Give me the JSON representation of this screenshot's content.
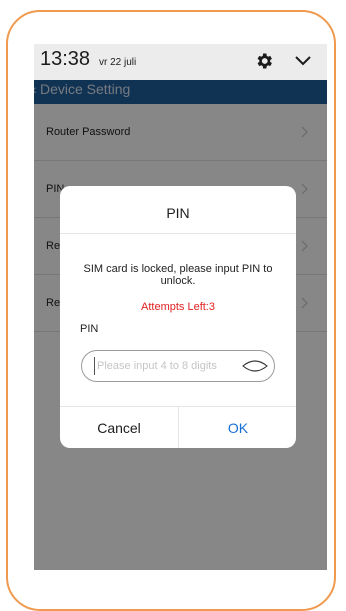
{
  "status_bar": {
    "time": "13:38",
    "date": "vr 22 juli",
    "icons": [
      "gear-icon",
      "chevron-down-icon"
    ]
  },
  "app_bar": {
    "title": "Device Setting",
    "back_icon": "back-arrow-icon",
    "color": "#1f5f9e"
  },
  "settings_list": [
    {
      "label": "Router Password"
    },
    {
      "label": "PIN"
    },
    {
      "label": "Re"
    },
    {
      "label": "Re"
    }
  ],
  "dialog": {
    "title": "PIN",
    "message": "SIM card is locked, please input PIN to unlock.",
    "attempts": "Attempts Left:3",
    "attempts_color": "#e02020",
    "pin_label": "PIN",
    "pin_placeholder": "Please input 4 to 8 digits",
    "pin_value": "",
    "cancel_label": "Cancel",
    "ok_label": "OK",
    "ok_color": "#1a6fd6"
  },
  "accent_frame_color": "#ef9a4e"
}
